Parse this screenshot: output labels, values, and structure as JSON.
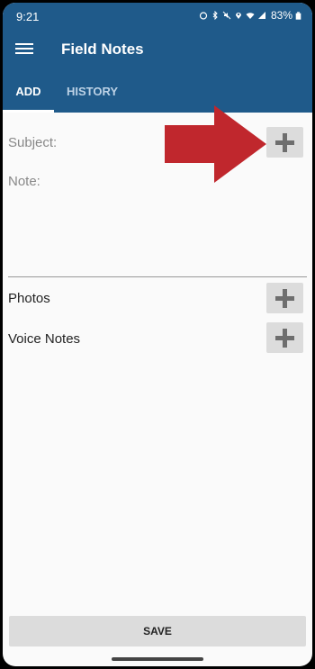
{
  "status_bar": {
    "time": "9:21",
    "icons": [
      "alarm-icon",
      "bluetooth-icon",
      "mute-icon",
      "location-icon",
      "wifi-icon",
      "signal-icon",
      "battery-icon"
    ],
    "battery_percent": "83%"
  },
  "app_bar": {
    "title": "Field Notes",
    "menu_icon": "hamburger-menu-icon"
  },
  "tabs": [
    {
      "label": "ADD",
      "selected": true
    },
    {
      "label": "HISTORY",
      "selected": false
    }
  ],
  "form": {
    "subject_label": "Subject:",
    "note_placeholder": "Note:",
    "photos_label": "Photos",
    "voice_notes_label": "Voice Notes"
  },
  "save_label": "SAVE",
  "colors": {
    "app_bar": "#1f5a8a",
    "arrow": "#c0272d",
    "button_bg": "#dcdcdc",
    "plus": "#6e6e6e"
  }
}
